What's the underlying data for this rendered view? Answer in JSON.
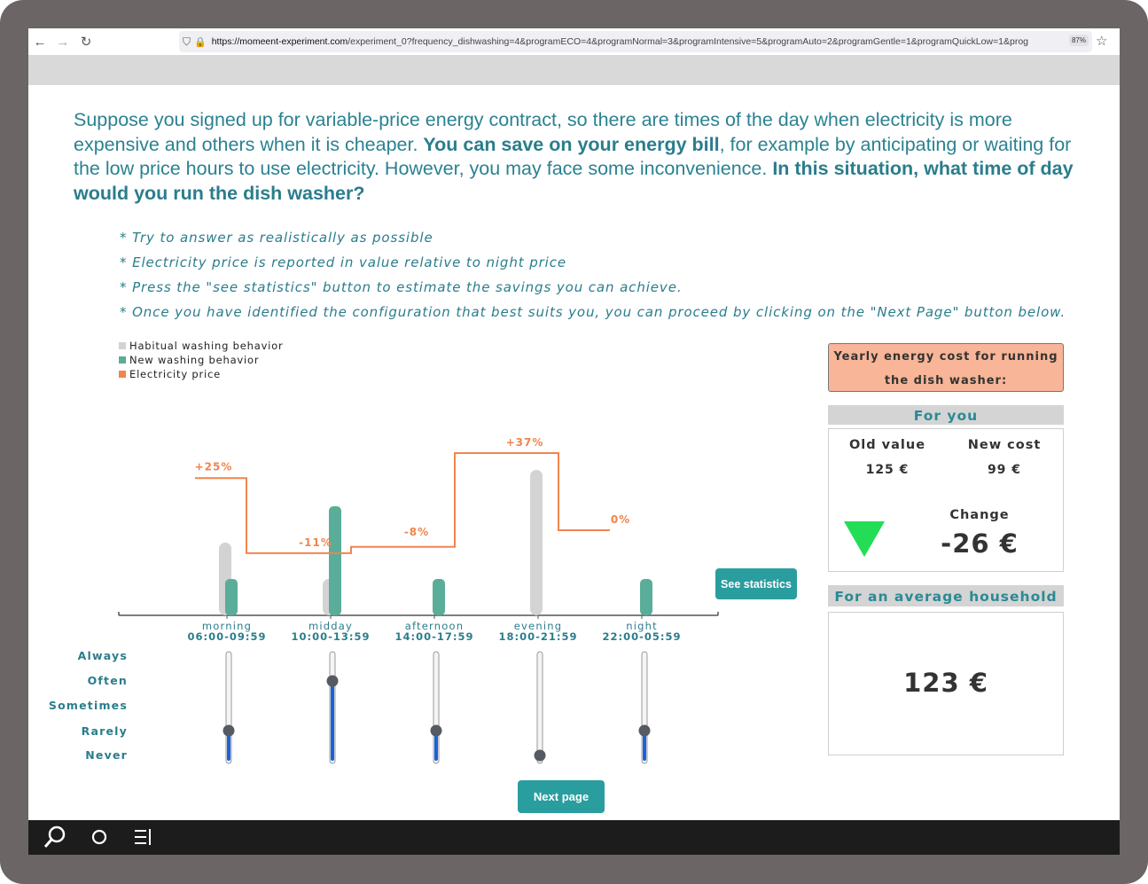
{
  "browser": {
    "url_domain": "https://momeent-experiment.com",
    "url_rest": "/experiment_0?frequency_dishwashing=4&programECO=4&programNormal=3&programIntensive=5&programAuto=2&programGentle=1&programQuickLow=1&prog",
    "zoom": "87%"
  },
  "intro": {
    "p1": "Suppose you signed up for variable-price energy contract, so there are times of the day when electricity is more expensive and others when it is cheaper. ",
    "b1": "You can save on your energy bill",
    "p2": ", for example by anticipating  or waiting  for the low price hours to use electricity. However, you may face some inconvenience. ",
    "b2": "In this situation, what time of day would you run the dish washer?"
  },
  "notes": [
    "* Try to answer as realistically as possible",
    "* Electricity price is reported in value relative to night price",
    "* Press the \"see statistics\" button to estimate the savings you can achieve.",
    "* Once you have identified the configuration that best suits you, you can proceed by clicking on the \"Next Page\" button below."
  ],
  "legend": [
    {
      "label": "Habitual washing behavior",
      "color": "#d3d3d3"
    },
    {
      "label": "New washing behavior",
      "color": "#5aad98"
    },
    {
      "label": "Electricity price",
      "color": "#f2844e"
    }
  ],
  "chart_data": {
    "type": "bar",
    "categories": [
      "morning",
      "midday",
      "afternoon",
      "evening",
      "night"
    ],
    "category_times": [
      "06:00-09:59",
      "10:00-13:59",
      "14:00-17:59",
      "18:00-21:59",
      "22:00-05:59"
    ],
    "series": [
      {
        "name": "Habitual washing behavior",
        "values": [
          2,
          1,
          0,
          4,
          0
        ],
        "color": "#d3d3d3"
      },
      {
        "name": "New washing behavior",
        "values": [
          1,
          3,
          1,
          0,
          1
        ],
        "color": "#5aad98"
      }
    ],
    "price_series": {
      "name": "Electricity price",
      "values": [
        25,
        -11,
        -8,
        37,
        0
      ],
      "labels": [
        "+25%",
        "-11%",
        "-8%",
        "+37%",
        "0%"
      ],
      "color": "#f2844e"
    },
    "ylim": [
      0,
      4
    ]
  },
  "frequency_levels": [
    "Always",
    "Often",
    "Sometimes",
    "Rarely",
    "Never"
  ],
  "sliders": [
    1,
    3,
    1,
    0,
    1
  ],
  "buttons": {
    "see_statistics": "See statistics",
    "next_page": "Next page"
  },
  "cost_panel": {
    "header": "Yearly energy cost for running the dish washer:",
    "for_you": "For you",
    "old_label": "Old value",
    "old_value": "125 €",
    "new_label": "New cost",
    "new_value": "99 €",
    "change_label": "Change",
    "change_value": "-26 €",
    "average_header": "For an average household",
    "average_value": "123 €"
  }
}
